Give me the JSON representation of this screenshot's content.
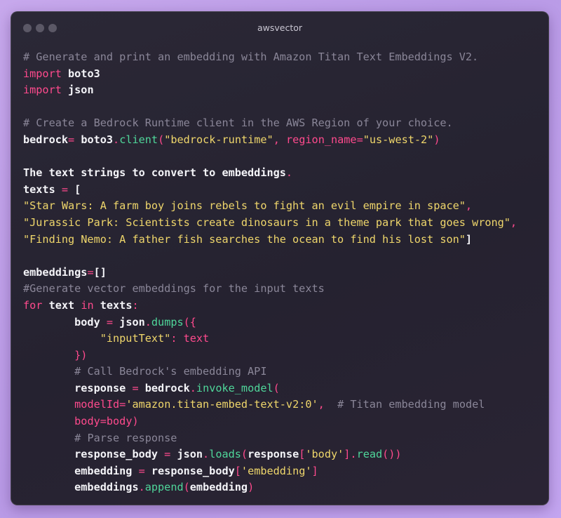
{
  "window": {
    "title": "awsvector"
  },
  "code": {
    "lines": [
      [
        {
          "t": "cm",
          "v": "# Generate and print an embedding with Amazon Titan Text Embeddings V2."
        }
      ],
      [
        {
          "t": "kw",
          "v": "import"
        },
        {
          "t": "pl",
          "v": " boto3"
        }
      ],
      [
        {
          "t": "kw",
          "v": "import"
        },
        {
          "t": "pl",
          "v": " json"
        }
      ],
      [],
      [
        {
          "t": "cm",
          "v": "# Create a Bedrock Runtime client in the AWS Region of your choice."
        }
      ],
      [
        {
          "t": "pl",
          "v": "bedrock"
        },
        {
          "t": "op",
          "v": "="
        },
        {
          "t": "pl",
          "v": " boto3"
        },
        {
          "t": "op",
          "v": "."
        },
        {
          "t": "fn",
          "v": "client"
        },
        {
          "t": "op",
          "v": "("
        },
        {
          "t": "str",
          "v": "\"bedrock-runtime\""
        },
        {
          "t": "op",
          "v": ", "
        },
        {
          "t": "kw",
          "v": "region_name"
        },
        {
          "t": "op",
          "v": "="
        },
        {
          "t": "str",
          "v": "\"us-west-2\""
        },
        {
          "t": "op",
          "v": ")"
        }
      ],
      [],
      [
        {
          "t": "pl",
          "v": "The text strings to convert to embeddings"
        },
        {
          "t": "op",
          "v": "."
        }
      ],
      [
        {
          "t": "pl",
          "v": "texts "
        },
        {
          "t": "op",
          "v": "="
        },
        {
          "t": "pl",
          "v": " ["
        }
      ],
      [
        {
          "t": "str",
          "v": "\"Star Wars: A farm boy joins rebels to fight an evil empire in space\""
        },
        {
          "t": "op",
          "v": ","
        }
      ],
      [
        {
          "t": "str",
          "v": "\"Jurassic Park: Scientists create dinosaurs in a theme park that goes wrong\""
        },
        {
          "t": "op",
          "v": ","
        }
      ],
      [
        {
          "t": "str",
          "v": "\"Finding Nemo: A father fish searches the ocean to find his lost son\""
        },
        {
          "t": "pl",
          "v": "]"
        }
      ],
      [],
      [
        {
          "t": "pl",
          "v": "embeddings"
        },
        {
          "t": "op",
          "v": "="
        },
        {
          "t": "pl",
          "v": "[]"
        }
      ],
      [
        {
          "t": "cm",
          "v": "#Generate vector embeddings for the input texts"
        }
      ],
      [
        {
          "t": "kw",
          "v": "for"
        },
        {
          "t": "pl",
          "v": " text "
        },
        {
          "t": "kw",
          "v": "in"
        },
        {
          "t": "pl",
          "v": " texts"
        },
        {
          "t": "op",
          "v": ":"
        }
      ],
      [
        {
          "t": "pl",
          "v": "        body "
        },
        {
          "t": "op",
          "v": "="
        },
        {
          "t": "pl",
          "v": " json"
        },
        {
          "t": "op",
          "v": "."
        },
        {
          "t": "fn",
          "v": "dumps"
        },
        {
          "t": "op",
          "v": "({"
        }
      ],
      [
        {
          "t": "pl",
          "v": "            "
        },
        {
          "t": "str",
          "v": "\"inputText\""
        },
        {
          "t": "op",
          "v": ": "
        },
        {
          "t": "kw",
          "v": "text"
        }
      ],
      [
        {
          "t": "pl",
          "v": "        "
        },
        {
          "t": "op",
          "v": "})"
        }
      ],
      [
        {
          "t": "pl",
          "v": "        "
        },
        {
          "t": "cm",
          "v": "# Call Bedrock's embedding API"
        }
      ],
      [
        {
          "t": "pl",
          "v": "        response "
        },
        {
          "t": "op",
          "v": "="
        },
        {
          "t": "pl",
          "v": " bedrock"
        },
        {
          "t": "op",
          "v": "."
        },
        {
          "t": "fn",
          "v": "invoke_model"
        },
        {
          "t": "op",
          "v": "("
        }
      ],
      [
        {
          "t": "pl",
          "v": "        "
        },
        {
          "t": "kw",
          "v": "modelId"
        },
        {
          "t": "op",
          "v": "="
        },
        {
          "t": "str",
          "v": "'amazon.titan-embed-text-v2:0'"
        },
        {
          "t": "op",
          "v": ","
        },
        {
          "t": "pl",
          "v": "  "
        },
        {
          "t": "cm",
          "v": "# Titan embedding model"
        }
      ],
      [
        {
          "t": "pl",
          "v": "        "
        },
        {
          "t": "kw",
          "v": "body"
        },
        {
          "t": "op",
          "v": "="
        },
        {
          "t": "kw",
          "v": "body"
        },
        {
          "t": "op",
          "v": ")"
        }
      ],
      [
        {
          "t": "pl",
          "v": "        "
        },
        {
          "t": "cm",
          "v": "# Parse response"
        }
      ],
      [
        {
          "t": "pl",
          "v": "        response_body "
        },
        {
          "t": "op",
          "v": "="
        },
        {
          "t": "pl",
          "v": " json"
        },
        {
          "t": "op",
          "v": "."
        },
        {
          "t": "fn",
          "v": "loads"
        },
        {
          "t": "op",
          "v": "("
        },
        {
          "t": "pl",
          "v": "response"
        },
        {
          "t": "op",
          "v": "["
        },
        {
          "t": "str",
          "v": "'body'"
        },
        {
          "t": "op",
          "v": "]."
        },
        {
          "t": "fn",
          "v": "read"
        },
        {
          "t": "op",
          "v": "())"
        }
      ],
      [
        {
          "t": "pl",
          "v": "        embedding "
        },
        {
          "t": "op",
          "v": "="
        },
        {
          "t": "pl",
          "v": " response_body"
        },
        {
          "t": "op",
          "v": "["
        },
        {
          "t": "str",
          "v": "'embedding'"
        },
        {
          "t": "op",
          "v": "]"
        }
      ],
      [
        {
          "t": "pl",
          "v": "        embeddings"
        },
        {
          "t": "op",
          "v": "."
        },
        {
          "t": "fn",
          "v": "append"
        },
        {
          "t": "op",
          "v": "("
        },
        {
          "t": "pl",
          "v": "embedding"
        },
        {
          "t": "op",
          "v": ")"
        }
      ]
    ]
  }
}
